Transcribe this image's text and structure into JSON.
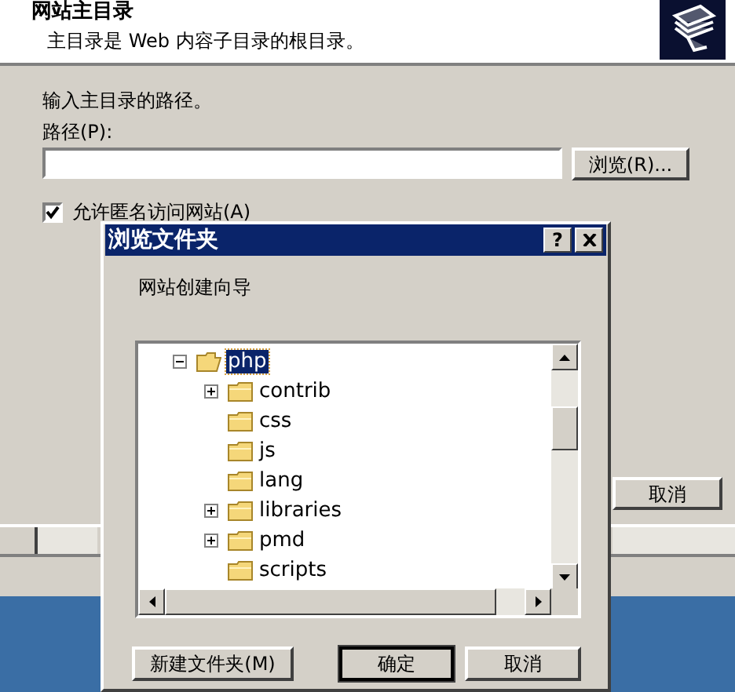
{
  "wizard": {
    "title": "网站主目录",
    "subtitle": "主目录是 Web 内容子目录的根目录。",
    "prompt": "输入主目录的路径。",
    "path_label": "路径(P):",
    "browse_button": "浏览(R)...",
    "anonymous_access": {
      "label": "允许匿名访问网站(A)",
      "checked": true
    },
    "cancel_button": "取消"
  },
  "dialog": {
    "title": "浏览文件夹",
    "help_button": "?",
    "description": "网站创建向导",
    "tree": [
      {
        "label": "php",
        "kind": "expandable",
        "expanded": true,
        "selected": true,
        "children": [
          {
            "label": "contrib",
            "kind": "expandable",
            "expanded": false,
            "selected": false
          },
          {
            "label": "css",
            "kind": "leaf",
            "selected": false
          },
          {
            "label": "js",
            "kind": "leaf",
            "selected": false
          },
          {
            "label": "lang",
            "kind": "leaf",
            "selected": false
          },
          {
            "label": "libraries",
            "kind": "expandable",
            "expanded": false,
            "selected": false
          },
          {
            "label": "pmd",
            "kind": "expandable",
            "expanded": false,
            "selected": false
          },
          {
            "label": "scripts",
            "kind": "leaf",
            "selected": false
          }
        ]
      }
    ],
    "buttons": [
      {
        "label": "新建文件夹(M)",
        "default": false
      },
      {
        "label": "确定",
        "default": true
      },
      {
        "label": "取消",
        "default": false
      }
    ]
  }
}
